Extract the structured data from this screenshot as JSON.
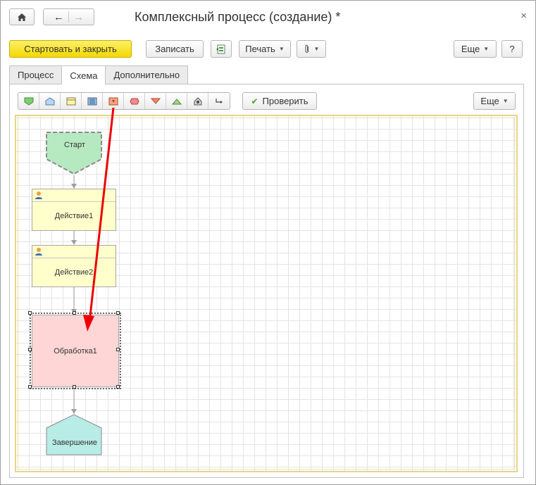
{
  "window": {
    "title": "Комплексный процесс (создание) *",
    "close_glyph": "×"
  },
  "nav": {
    "home_icon": "home-icon",
    "back_icon": "arrow-left-icon",
    "forward_icon": "arrow-right-icon"
  },
  "command_bar": {
    "start_and_close": "Стартовать и закрыть",
    "save": "Записать",
    "print": "Печать",
    "more": "Еще",
    "help": "?"
  },
  "tabs": [
    {
      "label": "Процесс",
      "active": false
    },
    {
      "label": "Схема",
      "active": true
    },
    {
      "label": "Дополнительно",
      "active": false
    }
  ],
  "scheme_toolbar": {
    "tools": [
      "start-point-tool",
      "end-point-tool",
      "action-tool",
      "subprocess-tool",
      "processing-tool",
      "condition-tool",
      "split-tool",
      "join-tool",
      "connector-tool",
      "connect-tool"
    ],
    "check": "Проверить",
    "more": "Еще"
  },
  "diagram": {
    "start": "Старт",
    "action1": "Действие1",
    "action2": "Действие2",
    "processing": "Обработка1",
    "finish": "Завершение"
  },
  "colors": {
    "accent_yellow": "#f3d800",
    "start_fill": "#b6e9c0",
    "action_fill": "#ffffcc",
    "processing_fill": "#ffd6d6",
    "finish_fill": "#b8ece6",
    "annotation_arrow": "#ee0000"
  }
}
